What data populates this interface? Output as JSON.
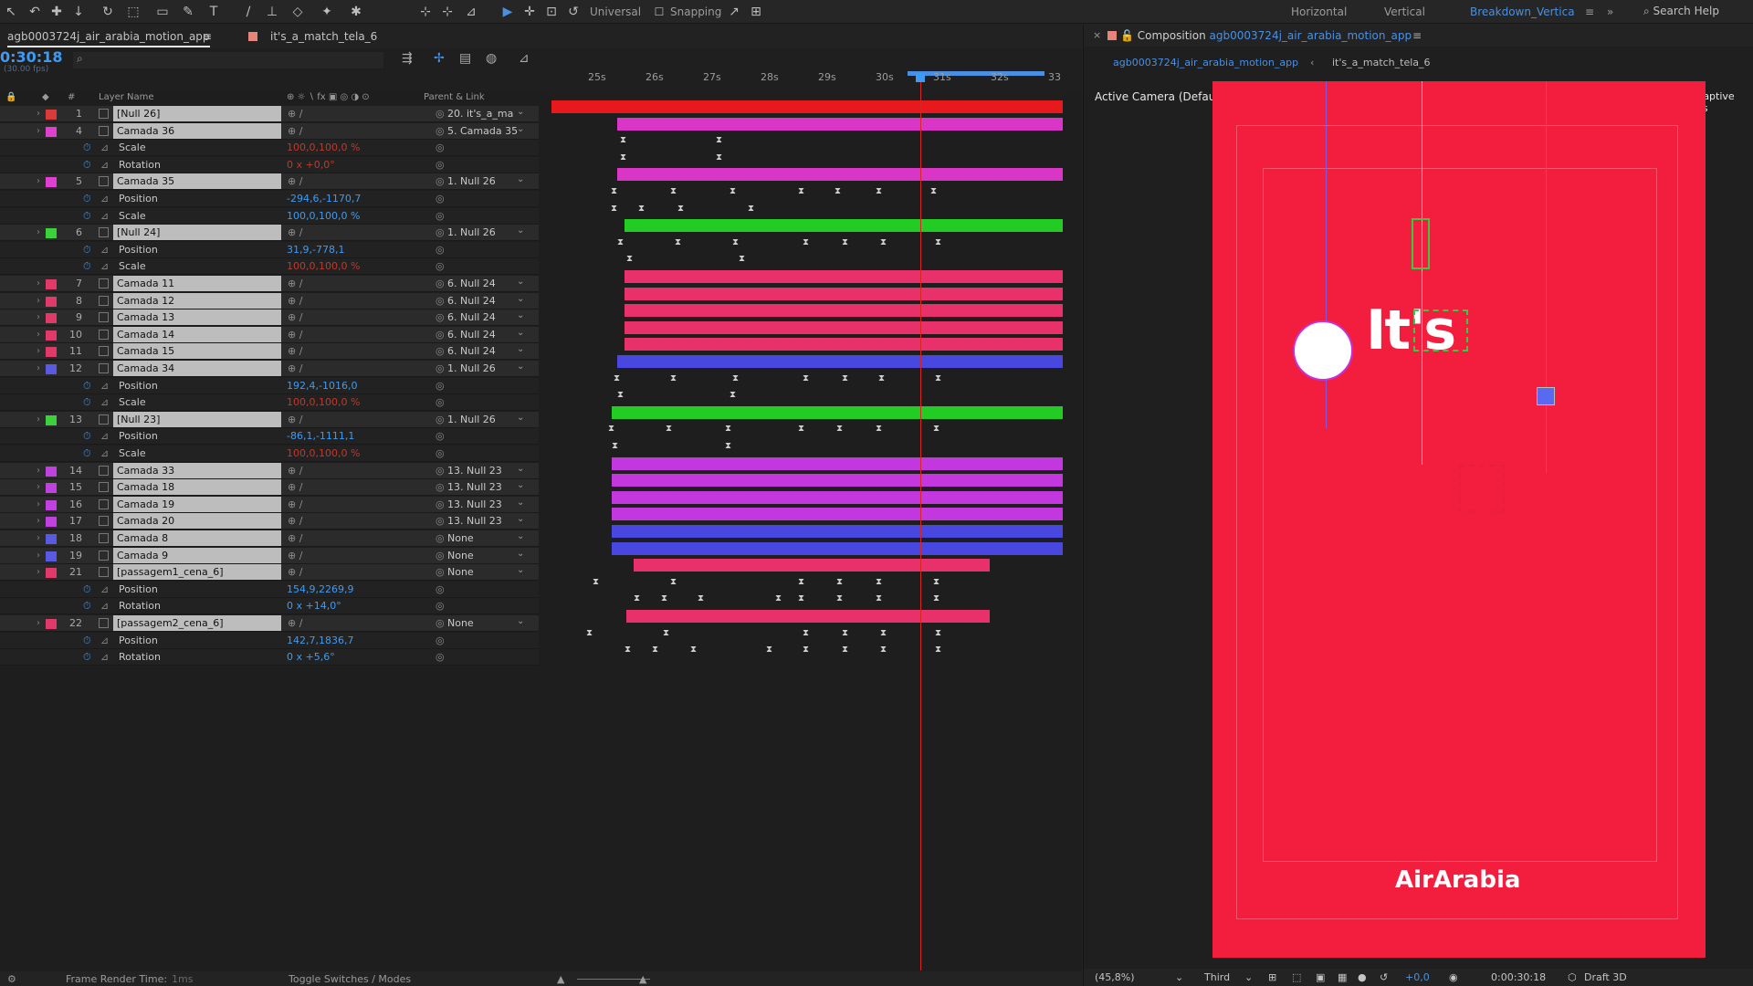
{
  "toolbar": {
    "universal": "Universal",
    "snapping": "Snapping",
    "workspaces": [
      "Horizontal",
      "Vertical",
      "Breakdown_Vertica"
    ],
    "search": "Search Help"
  },
  "left_tabs": [
    "agb0003724j_air_arabia_motion_app",
    "it's_a_match_tela_6"
  ],
  "timecode": "0:30:18",
  "fps": "(30.00 fps)",
  "headers": {
    "layer_name": "Layer Name",
    "parent": "Parent & Link"
  },
  "ruler": [
    "25s",
    "26s",
    "27s",
    "28s",
    "29s",
    "30s",
    "31s",
    "32s",
    "33"
  ],
  "rows": [
    {
      "type": "layer",
      "num": "1",
      "name": "[Null 26]",
      "color": "#d93a3a",
      "parent": "20. it's_a_ma",
      "bar": "#e8191c",
      "bs": 0,
      "be": 560
    },
    {
      "type": "layer",
      "num": "4",
      "name": "Camada 36",
      "color": "#e040d0",
      "parent": "5. Camada 35",
      "bar": "#d936c7",
      "bs": 72,
      "be": 560
    },
    {
      "type": "prop",
      "name": "Scale",
      "value": "100,0,100,0 %",
      "red": true,
      "kf": [
        75,
        180
      ]
    },
    {
      "type": "prop",
      "name": "Rotation",
      "value": "0 x +0,0°",
      "red": true,
      "kf": [
        75,
        180
      ]
    },
    {
      "type": "layer",
      "num": "5",
      "name": "Camada 35",
      "color": "#e040d0",
      "parent": "1. Null 26",
      "bar": "#d936c7",
      "bs": 72,
      "be": 560
    },
    {
      "type": "prop",
      "name": "Position",
      "value": "-294,6,-1170,7",
      "red": false,
      "kf": [
        65,
        130,
        195,
        270,
        310,
        355,
        415
      ]
    },
    {
      "type": "prop",
      "name": "Scale",
      "value": "100,0,100,0 %",
      "red": false,
      "kf": [
        65,
        95,
        138,
        215
      ]
    },
    {
      "type": "layer",
      "num": "6",
      "name": "[Null 24]",
      "color": "#3ad13a",
      "parent": "1. Null 26",
      "bar": "#22cc22",
      "bs": 80,
      "be": 560
    },
    {
      "type": "prop",
      "name": "Position",
      "value": "31,9,-778,1",
      "red": false,
      "kf": [
        72,
        135,
        198,
        275,
        318,
        360,
        420
      ]
    },
    {
      "type": "prop",
      "name": "Scale",
      "value": "100,0,100,0 %",
      "red": true,
      "kf": [
        82,
        205
      ]
    },
    {
      "type": "layer",
      "num": "7",
      "name": "Camada 11",
      "color": "#e03a6a",
      "parent": "6. Null 24",
      "bar": "#e8306a",
      "bs": 80,
      "be": 560
    },
    {
      "type": "layer",
      "num": "8",
      "name": "Camada 12",
      "color": "#e03a6a",
      "parent": "6. Null 24",
      "bar": "#e8306a",
      "bs": 80,
      "be": 560
    },
    {
      "type": "layer",
      "num": "9",
      "name": "Camada 13",
      "color": "#e03a6a",
      "parent": "6. Null 24",
      "bar": "#e8306a",
      "bs": 80,
      "be": 560
    },
    {
      "type": "layer",
      "num": "10",
      "name": "Camada 14",
      "color": "#e03a6a",
      "parent": "6. Null 24",
      "bar": "#e8306a",
      "bs": 80,
      "be": 560
    },
    {
      "type": "layer",
      "num": "11",
      "name": "Camada 15",
      "color": "#e03a6a",
      "parent": "6. Null 24",
      "bar": "#e8306a",
      "bs": 80,
      "be": 560
    },
    {
      "type": "layer",
      "num": "12",
      "name": "Camada 34",
      "color": "#5a5ae0",
      "parent": "1. Null 26",
      "bar": "#4848e0",
      "bs": 72,
      "be": 560
    },
    {
      "type": "prop",
      "name": "Position",
      "value": "192,4,-1016,0",
      "red": false,
      "kf": [
        68,
        130,
        198,
        275,
        318,
        358,
        420
      ]
    },
    {
      "type": "prop",
      "name": "Scale",
      "value": "100,0,100,0 %",
      "red": true,
      "kf": [
        72,
        195
      ]
    },
    {
      "type": "layer",
      "num": "13",
      "name": "[Null 23]",
      "color": "#3ad13a",
      "parent": "1. Null 26",
      "bar": "#22cc22",
      "bs": 66,
      "be": 560
    },
    {
      "type": "prop",
      "name": "Position",
      "value": "-86,1,-1111,1",
      "red": false,
      "kf": [
        62,
        125,
        190,
        270,
        312,
        355,
        418
      ]
    },
    {
      "type": "prop",
      "name": "Scale",
      "value": "100,0,100,0 %",
      "red": true,
      "kf": [
        66,
        190
      ]
    },
    {
      "type": "layer",
      "num": "14",
      "name": "Camada 33",
      "color": "#c040e0",
      "parent": "13. Null 23",
      "bar": "#c238de",
      "bs": 66,
      "be": 560
    },
    {
      "type": "layer",
      "num": "15",
      "name": "Camada 18",
      "color": "#c040e0",
      "parent": "13. Null 23",
      "bar": "#c238de",
      "bs": 66,
      "be": 560
    },
    {
      "type": "layer",
      "num": "16",
      "name": "Camada 19",
      "color": "#c040e0",
      "parent": "13. Null 23",
      "bar": "#c238de",
      "bs": 66,
      "be": 560
    },
    {
      "type": "layer",
      "num": "17",
      "name": "Camada 20",
      "color": "#c040e0",
      "parent": "13. Null 23",
      "bar": "#c238de",
      "bs": 66,
      "be": 560
    },
    {
      "type": "layer",
      "num": "18",
      "name": "Camada 8",
      "color": "#5a5ae0",
      "parent": "None",
      "bar": "#4848e0",
      "bs": 66,
      "be": 560
    },
    {
      "type": "layer",
      "num": "19",
      "name": "Camada 9",
      "color": "#5a5ae0",
      "parent": "None",
      "bar": "#4848e0",
      "bs": 66,
      "be": 560
    },
    {
      "type": "layer",
      "num": "21",
      "name": "[passagem1_cena_6]",
      "color": "#e03a6a",
      "parent": "None",
      "bar": "#e8306a",
      "bs": 90,
      "be": 480
    },
    {
      "type": "prop",
      "name": "Position",
      "value": "154,9,2269,9",
      "red": false,
      "kf": [
        45,
        130,
        270,
        312,
        355,
        418
      ]
    },
    {
      "type": "prop",
      "name": "Rotation",
      "value": "0 x +14,0°",
      "red": false,
      "kf": [
        90,
        120,
        160,
        245,
        270,
        312,
        355,
        418
      ]
    },
    {
      "type": "layer",
      "num": "22",
      "name": "[passagem2_cena_6]",
      "color": "#e03a6a",
      "parent": "None",
      "bar": "#e8306a",
      "bs": 82,
      "be": 480
    },
    {
      "type": "prop",
      "name": "Position",
      "value": "142,7,1836,7",
      "red": false,
      "kf": [
        38,
        122,
        275,
        318,
        360,
        420
      ]
    },
    {
      "type": "prop",
      "name": "Rotation",
      "value": "0 x +5,6°",
      "red": false,
      "kf": [
        80,
        110,
        152,
        235,
        275,
        318,
        360,
        420
      ]
    }
  ],
  "comp": {
    "label": "Composition",
    "name": "agb0003724j_air_arabia_motion_app",
    "subtabs": [
      "agb0003724j_air_arabia_motion_app",
      "it's_a_match_tela_6"
    ],
    "camera": "Active Camera (Default)",
    "adaptive": "Adaptive Res",
    "logo_text": "AirArabia",
    "its_text": "It's",
    "canvas_color": "#f31e3d"
  },
  "bottom": {
    "zoom": "(45,8%)",
    "view": "Third",
    "exposure": "+0,0",
    "time": "0:00:30:18",
    "renderer": "Draft 3D"
  },
  "status": {
    "render_time": "Frame Render Time:",
    "render_value": "1ms",
    "toggle": "Toggle Switches / Modes"
  }
}
